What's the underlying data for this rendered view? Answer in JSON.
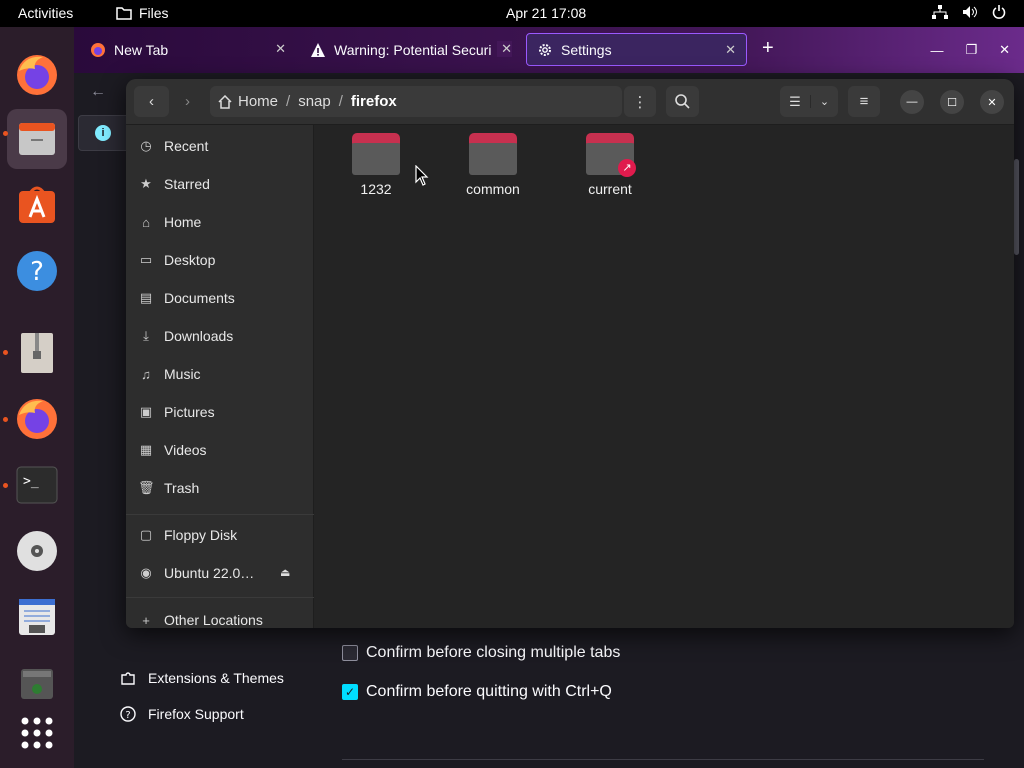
{
  "topbar": {
    "activities": "Activities",
    "app_name": "Files",
    "clock": "Apr 21  17:08"
  },
  "dock": {
    "items": [
      "firefox",
      "files",
      "app-center",
      "help",
      "archive-manager",
      "firefox",
      "terminal",
      "disc",
      "text-editor",
      "trash"
    ]
  },
  "firefox": {
    "tabs": [
      {
        "label": "New Tab"
      },
      {
        "label": "Warning: Potential Securi"
      },
      {
        "label": "Settings"
      }
    ],
    "sidebar": {
      "extensions": "Extensions & Themes",
      "support": "Firefox Support"
    },
    "checkboxes": [
      {
        "label": "Confirm before closing multiple tabs",
        "checked": false
      },
      {
        "label": "Confirm before quitting with Ctrl+Q",
        "checked": true
      }
    ]
  },
  "files": {
    "path": {
      "home": "Home",
      "snap": "snap",
      "current": "firefox"
    },
    "sidebar": [
      {
        "label": "Recent",
        "icon": "clock-icon"
      },
      {
        "label": "Starred",
        "icon": "star-icon"
      },
      {
        "label": "Home",
        "icon": "home-icon"
      },
      {
        "label": "Desktop",
        "icon": "desktop-icon"
      },
      {
        "label": "Documents",
        "icon": "document-icon"
      },
      {
        "label": "Downloads",
        "icon": "download-icon"
      },
      {
        "label": "Music",
        "icon": "music-icon"
      },
      {
        "label": "Pictures",
        "icon": "picture-icon"
      },
      {
        "label": "Videos",
        "icon": "video-icon"
      },
      {
        "label": "Trash",
        "icon": "trash-icon"
      }
    ],
    "devices": [
      {
        "label": "Floppy Disk",
        "icon": "floppy-icon"
      },
      {
        "label": "Ubuntu 22.0…",
        "icon": "disc-icon"
      }
    ],
    "other_locations": "Other Locations",
    "folders": [
      {
        "name": "1232",
        "link": false
      },
      {
        "name": "common",
        "link": false
      },
      {
        "name": "current",
        "link": true
      }
    ]
  }
}
